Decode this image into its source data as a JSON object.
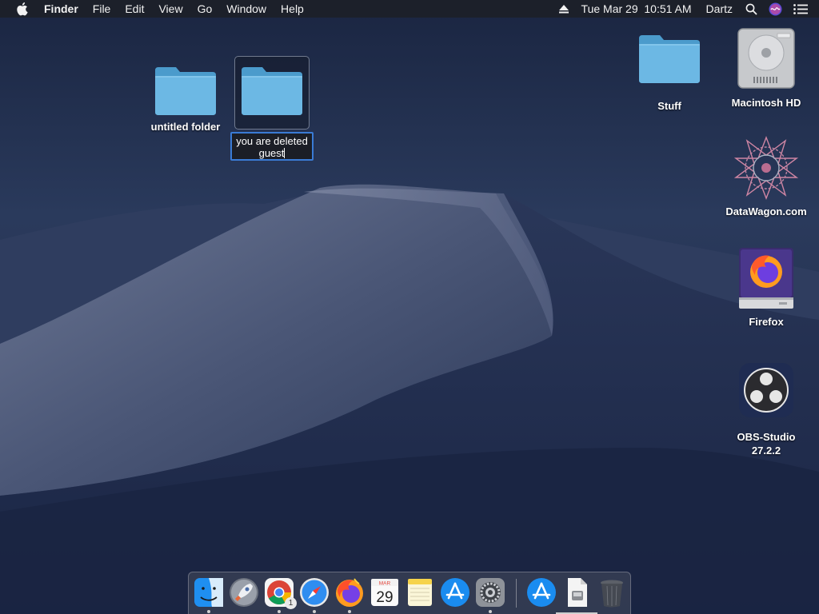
{
  "menubar": {
    "app_name": "Finder",
    "menus": [
      "File",
      "Edit",
      "View",
      "Go",
      "Window",
      "Help"
    ],
    "clock": "Tue Mar 29  10:51 AM",
    "user": "Dartz"
  },
  "desktop": {
    "icons": [
      {
        "label": "untitled folder"
      },
      {
        "label": "Stuff"
      },
      {
        "label": "Macintosh HD"
      },
      {
        "label": "DataWagon.com"
      },
      {
        "label": "Firefox"
      },
      {
        "label": "OBS-Studio\n27.2.2"
      }
    ],
    "rename_field": {
      "line1": "you are deleted",
      "line2": "guest"
    }
  },
  "dock": {
    "apps": [
      "finder",
      "launchpad",
      "chrome",
      "safari",
      "firefox",
      "calendar",
      "notes",
      "app-store",
      "system-preferences",
      "downloads",
      "document",
      "trash"
    ],
    "calendar": {
      "month": "MAR",
      "day": "29"
    },
    "chrome_badge": "1"
  },
  "colors": {
    "accent": "#3a7bd5",
    "folder": "#6cb8e4",
    "menubar": "#1c1f28"
  }
}
